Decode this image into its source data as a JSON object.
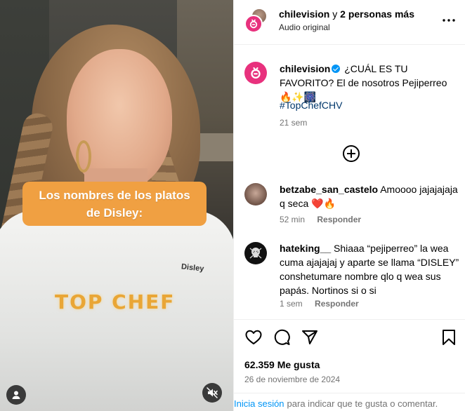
{
  "media": {
    "caption_line1": "Los nombres de los platos",
    "caption_line2": "de Disley:",
    "show_logo": "TOP CHEF",
    "name_tag": "Disley",
    "user_icon": "user-icon",
    "mute_icon": "muted-speaker-icon"
  },
  "header": {
    "account": "chilevision",
    "and_text": " y ",
    "others": "2 personas más",
    "audio": "Audio original",
    "more_icon": "more-options-icon"
  },
  "post": {
    "username": "chilevision",
    "caption": "¿CUÁL ES TU FAVORITO? El de nosotros Pejiperreo 🔥✨🎆",
    "hashtag": "#TopChefCHV",
    "time": "21 sem",
    "load_more_icon": "plus-circle-icon"
  },
  "comments": [
    {
      "username": "betzabe_san_castelo",
      "text": "Amoooo jajajajaja q seca ❤️🔥",
      "time": "52 min",
      "reply": "Responder"
    },
    {
      "username": "hateking__",
      "text": "Shiaaa “pejiperreo” la wea cuma ajajajaj y aparte se llama “DISLEY” conshetumare nombre qlo q wea sus papás. Nortinos si o si",
      "time": "1 sem",
      "reply": "Responder"
    }
  ],
  "actions": {
    "like_icon": "heart-icon",
    "comment_icon": "comment-icon",
    "share_icon": "share-icon",
    "save_icon": "bookmark-icon",
    "likes": "62.359 Me gusta",
    "date": "26 de noviembre de 2024"
  },
  "login": {
    "link": "Inicia sesión",
    "text": "para indicar que te gusta o comentar."
  },
  "colors": {
    "brand_pink": "#e8317d",
    "link_blue": "#0095f6",
    "hashtag_blue": "#00376b",
    "caption_orange": "#f0a042"
  }
}
